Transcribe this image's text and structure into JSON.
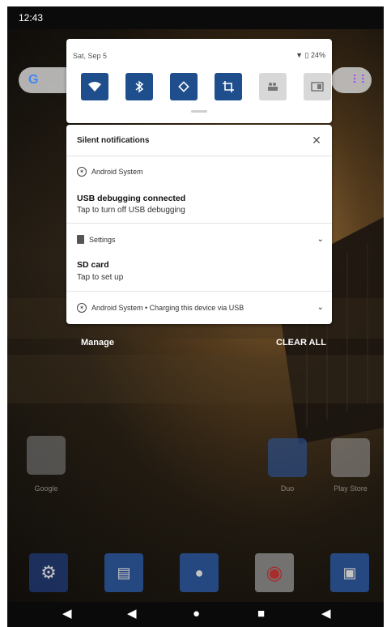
{
  "status_bar": {
    "time": "12:43"
  },
  "launcher": {
    "search_logo": "G",
    "search_logo_partial": "G",
    "apps_icon": "google-apps-icon",
    "home_apps": [
      {
        "label": "Google"
      },
      {
        "label": "Duo"
      },
      {
        "label": "Play Store"
      }
    ],
    "dock_apps": [
      "settings-icon",
      "messages-icon",
      "contacts-icon",
      "chrome-icon",
      "camera-icon"
    ]
  },
  "quick_settings": {
    "date": "Sat, Sep 5",
    "battery": "24%",
    "tiles": [
      {
        "name": "wifi",
        "on": true
      },
      {
        "name": "bluetooth",
        "on": true
      },
      {
        "name": "auto-rotate",
        "on": true
      },
      {
        "name": "screenshot-crop",
        "on": true
      },
      {
        "name": "meet",
        "on": false
      },
      {
        "name": "cast",
        "on": false
      }
    ]
  },
  "notifications": {
    "header": "Silent notifications",
    "cards": [
      {
        "app": "Android System",
        "title": "USB debugging connected",
        "text": "Tap to turn off USB debugging"
      },
      {
        "app": "Settings",
        "title": "SD card",
        "text": "Tap to set up"
      },
      {
        "app": "Android System • Charging this device via USB"
      }
    ],
    "manage_label": "Manage",
    "clear_all_label": "CLEAR ALL"
  },
  "navigation": [
    "volume-down-icon",
    "back-icon",
    "home-icon",
    "recents-icon",
    "volume-up-icon"
  ],
  "colors": {
    "tile_on": "#1f4e8c",
    "tile_off": "#d8d8d8",
    "nav_bg": "#0a0a0a"
  }
}
